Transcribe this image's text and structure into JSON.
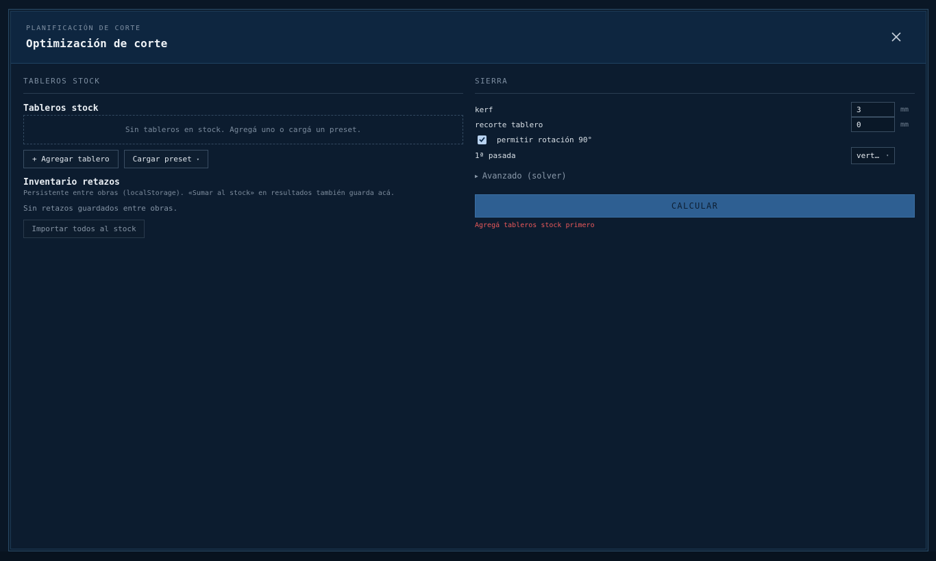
{
  "header": {
    "eyebrow": "PLANIFICACIÓN DE CORTE",
    "title": "Optimización de corte",
    "close_icon": "close-icon"
  },
  "stock": {
    "section_title": "TABLEROS STOCK",
    "subtitle": "Tableros stock",
    "empty_text": "Sin tableros en stock. Agregá uno o cargá un preset.",
    "add_button": "+ Agregar tablero",
    "preset_button": "Cargar preset",
    "preset_caret": "▾"
  },
  "inventory": {
    "title": "Inventario retazos",
    "description": "Persistente entre obras (localStorage). «Sumar al stock» en resultados también guarda acá.",
    "empty_text": "Sin retazos guardados entre obras.",
    "import_button": "Importar todos al stock"
  },
  "saw": {
    "section_title": "SIERRA",
    "kerf": {
      "label": "kerf",
      "value": "3",
      "unit": "mm"
    },
    "trim": {
      "label": "recorte tablero",
      "value": "0",
      "unit": "mm"
    },
    "rotation": {
      "label": "permitir rotación 90°",
      "checked": true
    },
    "first_pass": {
      "label": "1ª pasada",
      "value": "vert…",
      "caret": "▾"
    },
    "advanced": "Avanzado (solver)",
    "calculate_button": "CALCULAR",
    "error": "Agregá tableros stock primero"
  },
  "colors": {
    "accent": "#2e5f92",
    "error": "#e8585a",
    "background": "#0c1c2f"
  }
}
